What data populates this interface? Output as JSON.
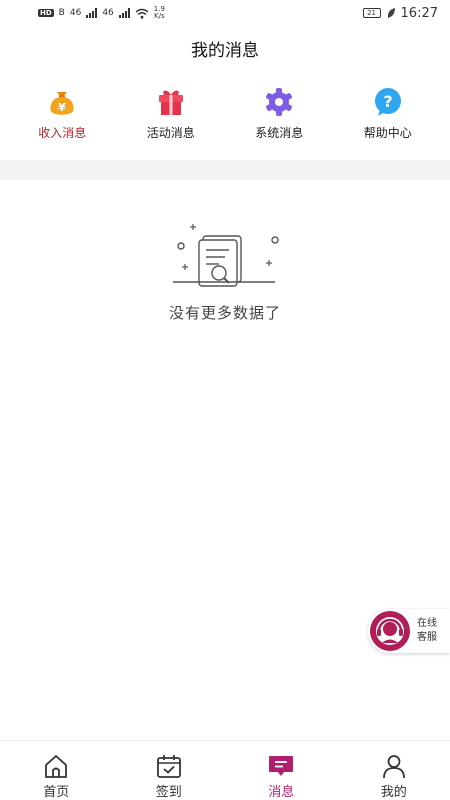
{
  "status_bar": {
    "hd": "HD",
    "net1": "B",
    "signal1": "46",
    "signal2": "46",
    "speed_value": "1.9",
    "speed_unit": "K/s",
    "battery": "21",
    "time": "16:27"
  },
  "header": {
    "title": "我的消息"
  },
  "categories": [
    {
      "label": "收入消息",
      "icon": "money-bag-icon",
      "color": "#f0a020"
    },
    {
      "label": "活动消息",
      "icon": "gift-icon",
      "color": "#e5334b"
    },
    {
      "label": "系统消息",
      "icon": "gear-icon",
      "color": "#7f5ce6"
    },
    {
      "label": "帮助中心",
      "icon": "help-icon",
      "color": "#2ea7f0"
    }
  ],
  "active_category": "收入消息",
  "empty": {
    "text": "没有更多数据了",
    "icon": "empty-document-search-icon"
  },
  "service": {
    "line1": "在线",
    "line2": "客服",
    "color": "#b01e55"
  },
  "tabs": [
    {
      "label": "首页",
      "icon": "home-icon"
    },
    {
      "label": "签到",
      "icon": "calendar-check-icon"
    },
    {
      "label": "消息",
      "icon": "message-icon"
    },
    {
      "label": "我的",
      "icon": "user-icon"
    }
  ],
  "active_tab": "消息",
  "colors": {
    "accent": "#b01e6e",
    "active_category": "#b3262e",
    "separator": "#f3f3f3"
  }
}
